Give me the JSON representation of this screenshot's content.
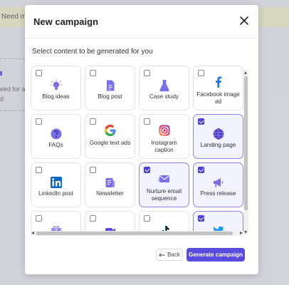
{
  "background": {
    "banner_text": "Need mor",
    "side_text_line1": "eed for a",
    "side_text_line2": "d"
  },
  "modal": {
    "title": "New campaign",
    "prompt": "Select content to be generated for you",
    "back_label": "Back",
    "generate_label": "Generate campaign"
  },
  "colors": {
    "accent": "#574be0",
    "selected_border": "#8c84e8",
    "selected_bg": "#f3f2ff"
  },
  "cards": [
    {
      "label": "Blog ideas",
      "checked": false,
      "icon": "lightbulb-icon"
    },
    {
      "label": "Blog post",
      "checked": false,
      "icon": "document-icon"
    },
    {
      "label": "Case study",
      "checked": false,
      "icon": "flask-icon"
    },
    {
      "label": "Facebook image ad",
      "checked": false,
      "icon": "facebook-icon"
    },
    {
      "label": "FAQs",
      "checked": false,
      "icon": "question-icon"
    },
    {
      "label": "Google text ads",
      "checked": false,
      "icon": "google-icon"
    },
    {
      "label": "Instagram caption",
      "checked": false,
      "icon": "instagram-icon"
    },
    {
      "label": "Landing page",
      "checked": true,
      "icon": "globe-icon"
    },
    {
      "label": "LinkedIn post",
      "checked": false,
      "icon": "linkedin-icon"
    },
    {
      "label": "Newsletter",
      "checked": false,
      "icon": "newsletter-icon"
    },
    {
      "label": "Nurture email sequence",
      "checked": true,
      "icon": "email-icon"
    },
    {
      "label": "Press release",
      "checked": true,
      "icon": "megaphone-icon"
    },
    {
      "label": "",
      "checked": false,
      "icon": "gift-icon"
    },
    {
      "label": "",
      "checked": false,
      "icon": "video-icon"
    },
    {
      "label": "",
      "checked": false,
      "icon": "tiktok-icon"
    },
    {
      "label": "",
      "checked": true,
      "icon": "twitter-icon"
    }
  ]
}
